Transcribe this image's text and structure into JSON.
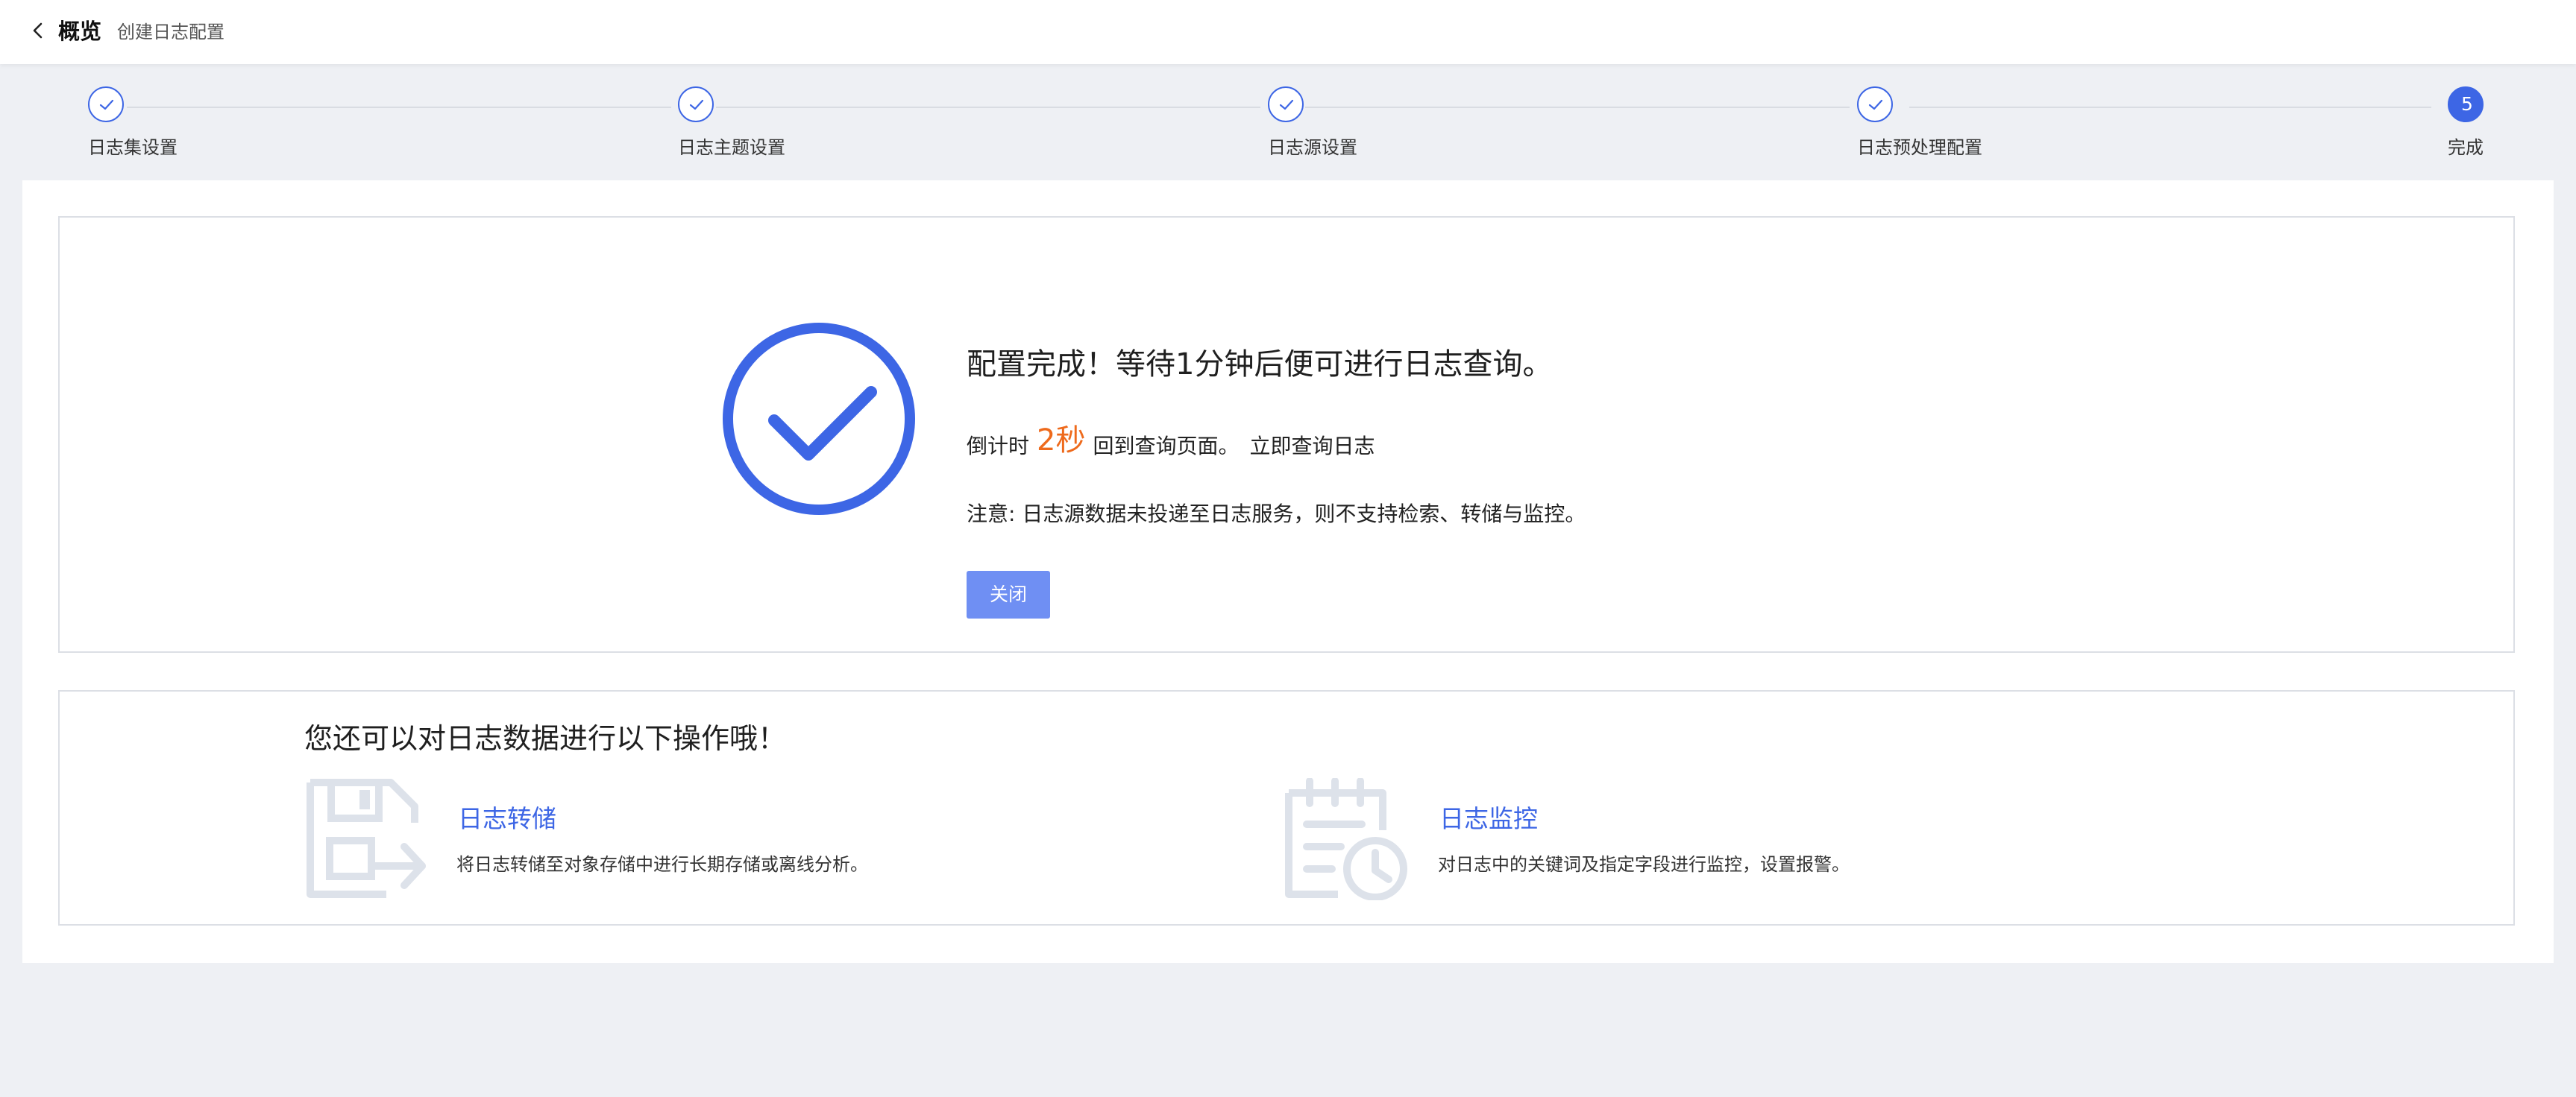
{
  "header": {
    "title": "概览",
    "subtitle": "创建日志配置"
  },
  "steps": [
    {
      "label": "日志集设置",
      "status": "done"
    },
    {
      "label": "日志主题设置",
      "status": "done"
    },
    {
      "label": "日志源设置",
      "status": "done"
    },
    {
      "label": "日志预处理配置",
      "status": "done"
    },
    {
      "label": "完成",
      "status": "active",
      "number": "5"
    }
  ],
  "result": {
    "title": "配置完成！等待1分钟后便可进行日志查询。",
    "countdown_prefix": "倒计时",
    "countdown_value": "2秒",
    "countdown_suffix": "回到查询页面。",
    "query_link": "立即查询日志",
    "note": "注意: 日志源数据未投递至日志服务，则不支持检索、转储与监控。",
    "close_label": "关闭"
  },
  "more": {
    "title": "您还可以对日志数据进行以下操作哦！",
    "features": [
      {
        "title": "日志转储",
        "description": "将日志转储至对象存储中进行长期存储或离线分析。",
        "icon": "export-save-icon"
      },
      {
        "title": "日志监控",
        "description": "对日志中的关键词及指定字段进行监控，设置报警。",
        "icon": "calendar-clock-icon"
      }
    ]
  },
  "colors": {
    "primary": "#3d66e5",
    "button": "#6f8ff3",
    "countdown": "#ee6a1c",
    "background": "#eef0f4",
    "icon_muted": "#dde2ea"
  }
}
